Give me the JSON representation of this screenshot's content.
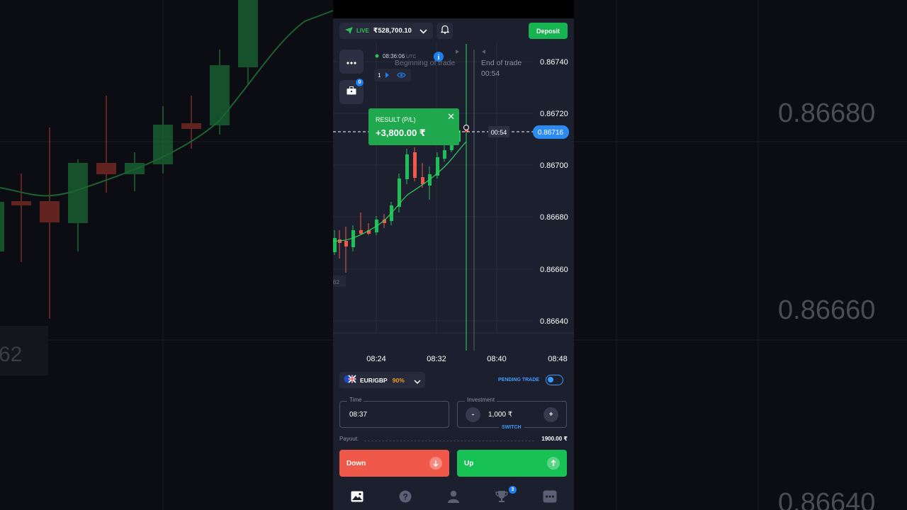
{
  "background": {
    "price_labels": [
      "0.86680",
      "0.86660",
      "0.86640"
    ],
    "corner_label": "62"
  },
  "header": {
    "account_mode": "LIVE",
    "balance": "₹528,700.10",
    "deposit_label": "Deposit"
  },
  "chart": {
    "time_utc": "08:36:06",
    "utc_label": "UTC",
    "beginning_label": "Beginning of trade",
    "end_label": "End of trade",
    "end_countdown": "00:54",
    "countdown_tag": "00:54",
    "current_price": "0.86716",
    "trade_count": "1",
    "left_edge_label": "62",
    "portfolio_badge": "0",
    "y_ticks": [
      "0.86740",
      "0.86720",
      "0.86700",
      "0.86680",
      "0.86660",
      "0.86640"
    ],
    "x_ticks": [
      "08:24",
      "08:32",
      "08:40",
      "08:48"
    ]
  },
  "result_popup": {
    "label": "RESULT (P/L)",
    "value": "+3,800.00 ₹"
  },
  "asset": {
    "pair": "EUR/GBP",
    "payout_pct": "90%",
    "pending_label": "PENDING TRADE"
  },
  "form": {
    "time_label": "Time",
    "time_value": "08:37",
    "investment_label": "Investment",
    "investment_value": "1,000 ₹",
    "minus": "-",
    "plus": "+",
    "switch_label": "SWITCH",
    "payout_label": "Payout:",
    "payout_value": "1900.00 ₹"
  },
  "actions": {
    "down_label": "Down",
    "up_label": "Up"
  },
  "nav": {
    "trophy_badge": "3"
  },
  "colors": {
    "up": "#17b350",
    "down": "#f0584a",
    "accent": "#1e7ff0",
    "panel": "#1c1f2d"
  }
}
